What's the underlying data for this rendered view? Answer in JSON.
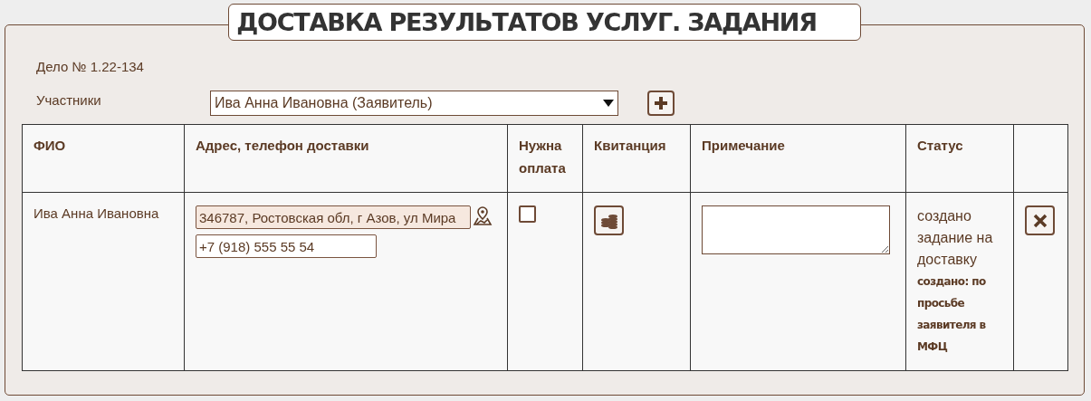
{
  "title": "ДОСТАВКА РЕЗУЛЬТАТОВ УСЛУГ. ЗАДАНИЯ",
  "case": "Дело № 1.22-134",
  "participants": {
    "label": "Участники",
    "value": "Ива Анна Ивановна (Заявитель)"
  },
  "table": {
    "columns": [
      "ФИО",
      "Адрес, телефон доставки",
      "Нужна оплата",
      "Квитанция",
      "Примечание",
      "Статус"
    ],
    "rows": [
      {
        "name": "Ива Анна Ивановна",
        "address": "346787, Ростовская обл, г Азов, ул Мира",
        "phone": "+7 (918) 555 55 54",
        "payment_needed": false,
        "status": "создано задание на доставку",
        "status_note": "создано: по просьбе заявителя в МФЦ"
      }
    ]
  }
}
